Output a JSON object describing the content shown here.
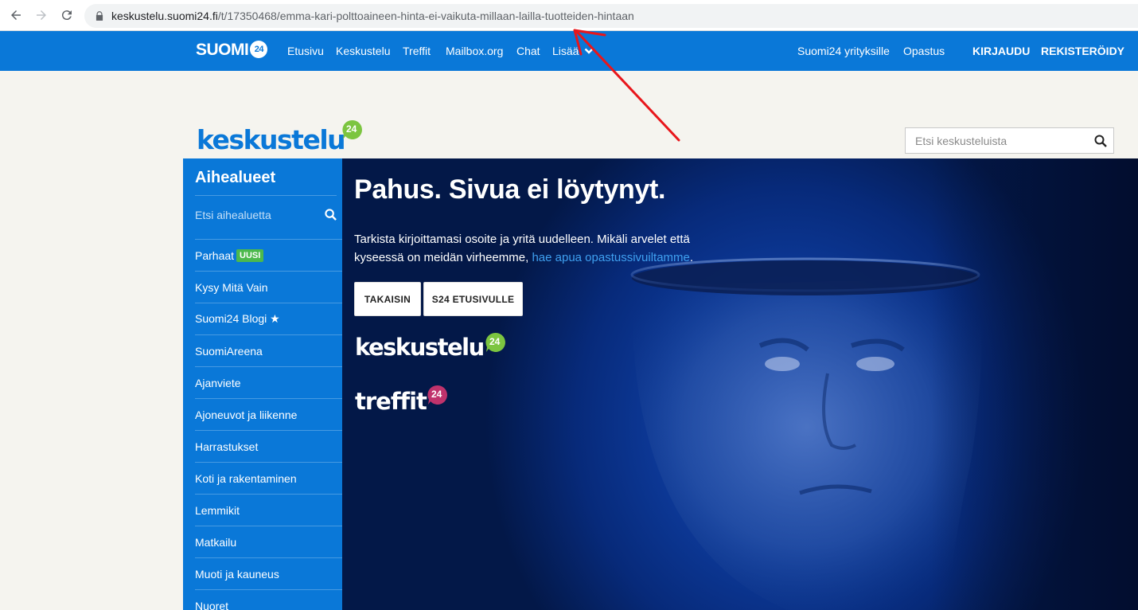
{
  "browser": {
    "url_host": "keskustelu.suomi24.fi",
    "url_path": "/t/17350468/emma-kari-polttoaineen-hinta-ei-vaikuta-millaan-lailla-tuotteiden-hintaan"
  },
  "topnav": {
    "logo": "SUOMI",
    "logo_badge": "24",
    "links": [
      "Etusivu",
      "Keskustelu",
      "Treffit",
      "Mailbox.org",
      "Chat",
      "Lisää"
    ],
    "right_links": [
      "Suomi24 yrityksille",
      "Opastus"
    ],
    "login": "KIRJAUDU",
    "register": "REKISTERÖIDY"
  },
  "header": {
    "logo_word": "keskustelu",
    "logo_badge": "24",
    "search_placeholder": "Etsi keskusteluista"
  },
  "sidebar": {
    "title": "Aihealueet",
    "search_placeholder": "Etsi aihealuetta",
    "new_badge": "UUSI",
    "items": [
      "Parhaat",
      "Kysy Mitä Vain",
      "Suomi24 Blogi ★",
      "SuomiAreena",
      "Ajanviete",
      "Ajoneuvot ja liikenne",
      "Harrastukset",
      "Koti ja rakentaminen",
      "Lemmikit",
      "Matkailu",
      "Muoti ja kauneus",
      "Nuoret"
    ]
  },
  "hero": {
    "title": "Pahus. Sivua ei löytynyt.",
    "text_before": "Tarkista kirjoittamasi osoite ja yritä uudelleen. Mikäli arvelet että kyseessä on meidän virheemme, ",
    "link_text": "hae apua opastussivuiltamme",
    "text_after": ".",
    "back_button": "TAKAISIN",
    "home_button": "S24 ETUSIVULLE",
    "brand_keskustelu": "keskustelu",
    "brand_treffit": "treffit",
    "brand_badge": "24"
  },
  "colors": {
    "brand_blue": "#0a78d8",
    "green_badge": "#7cc540",
    "treffit_badge": "#c0336c",
    "annotation_red": "#e8161b"
  }
}
